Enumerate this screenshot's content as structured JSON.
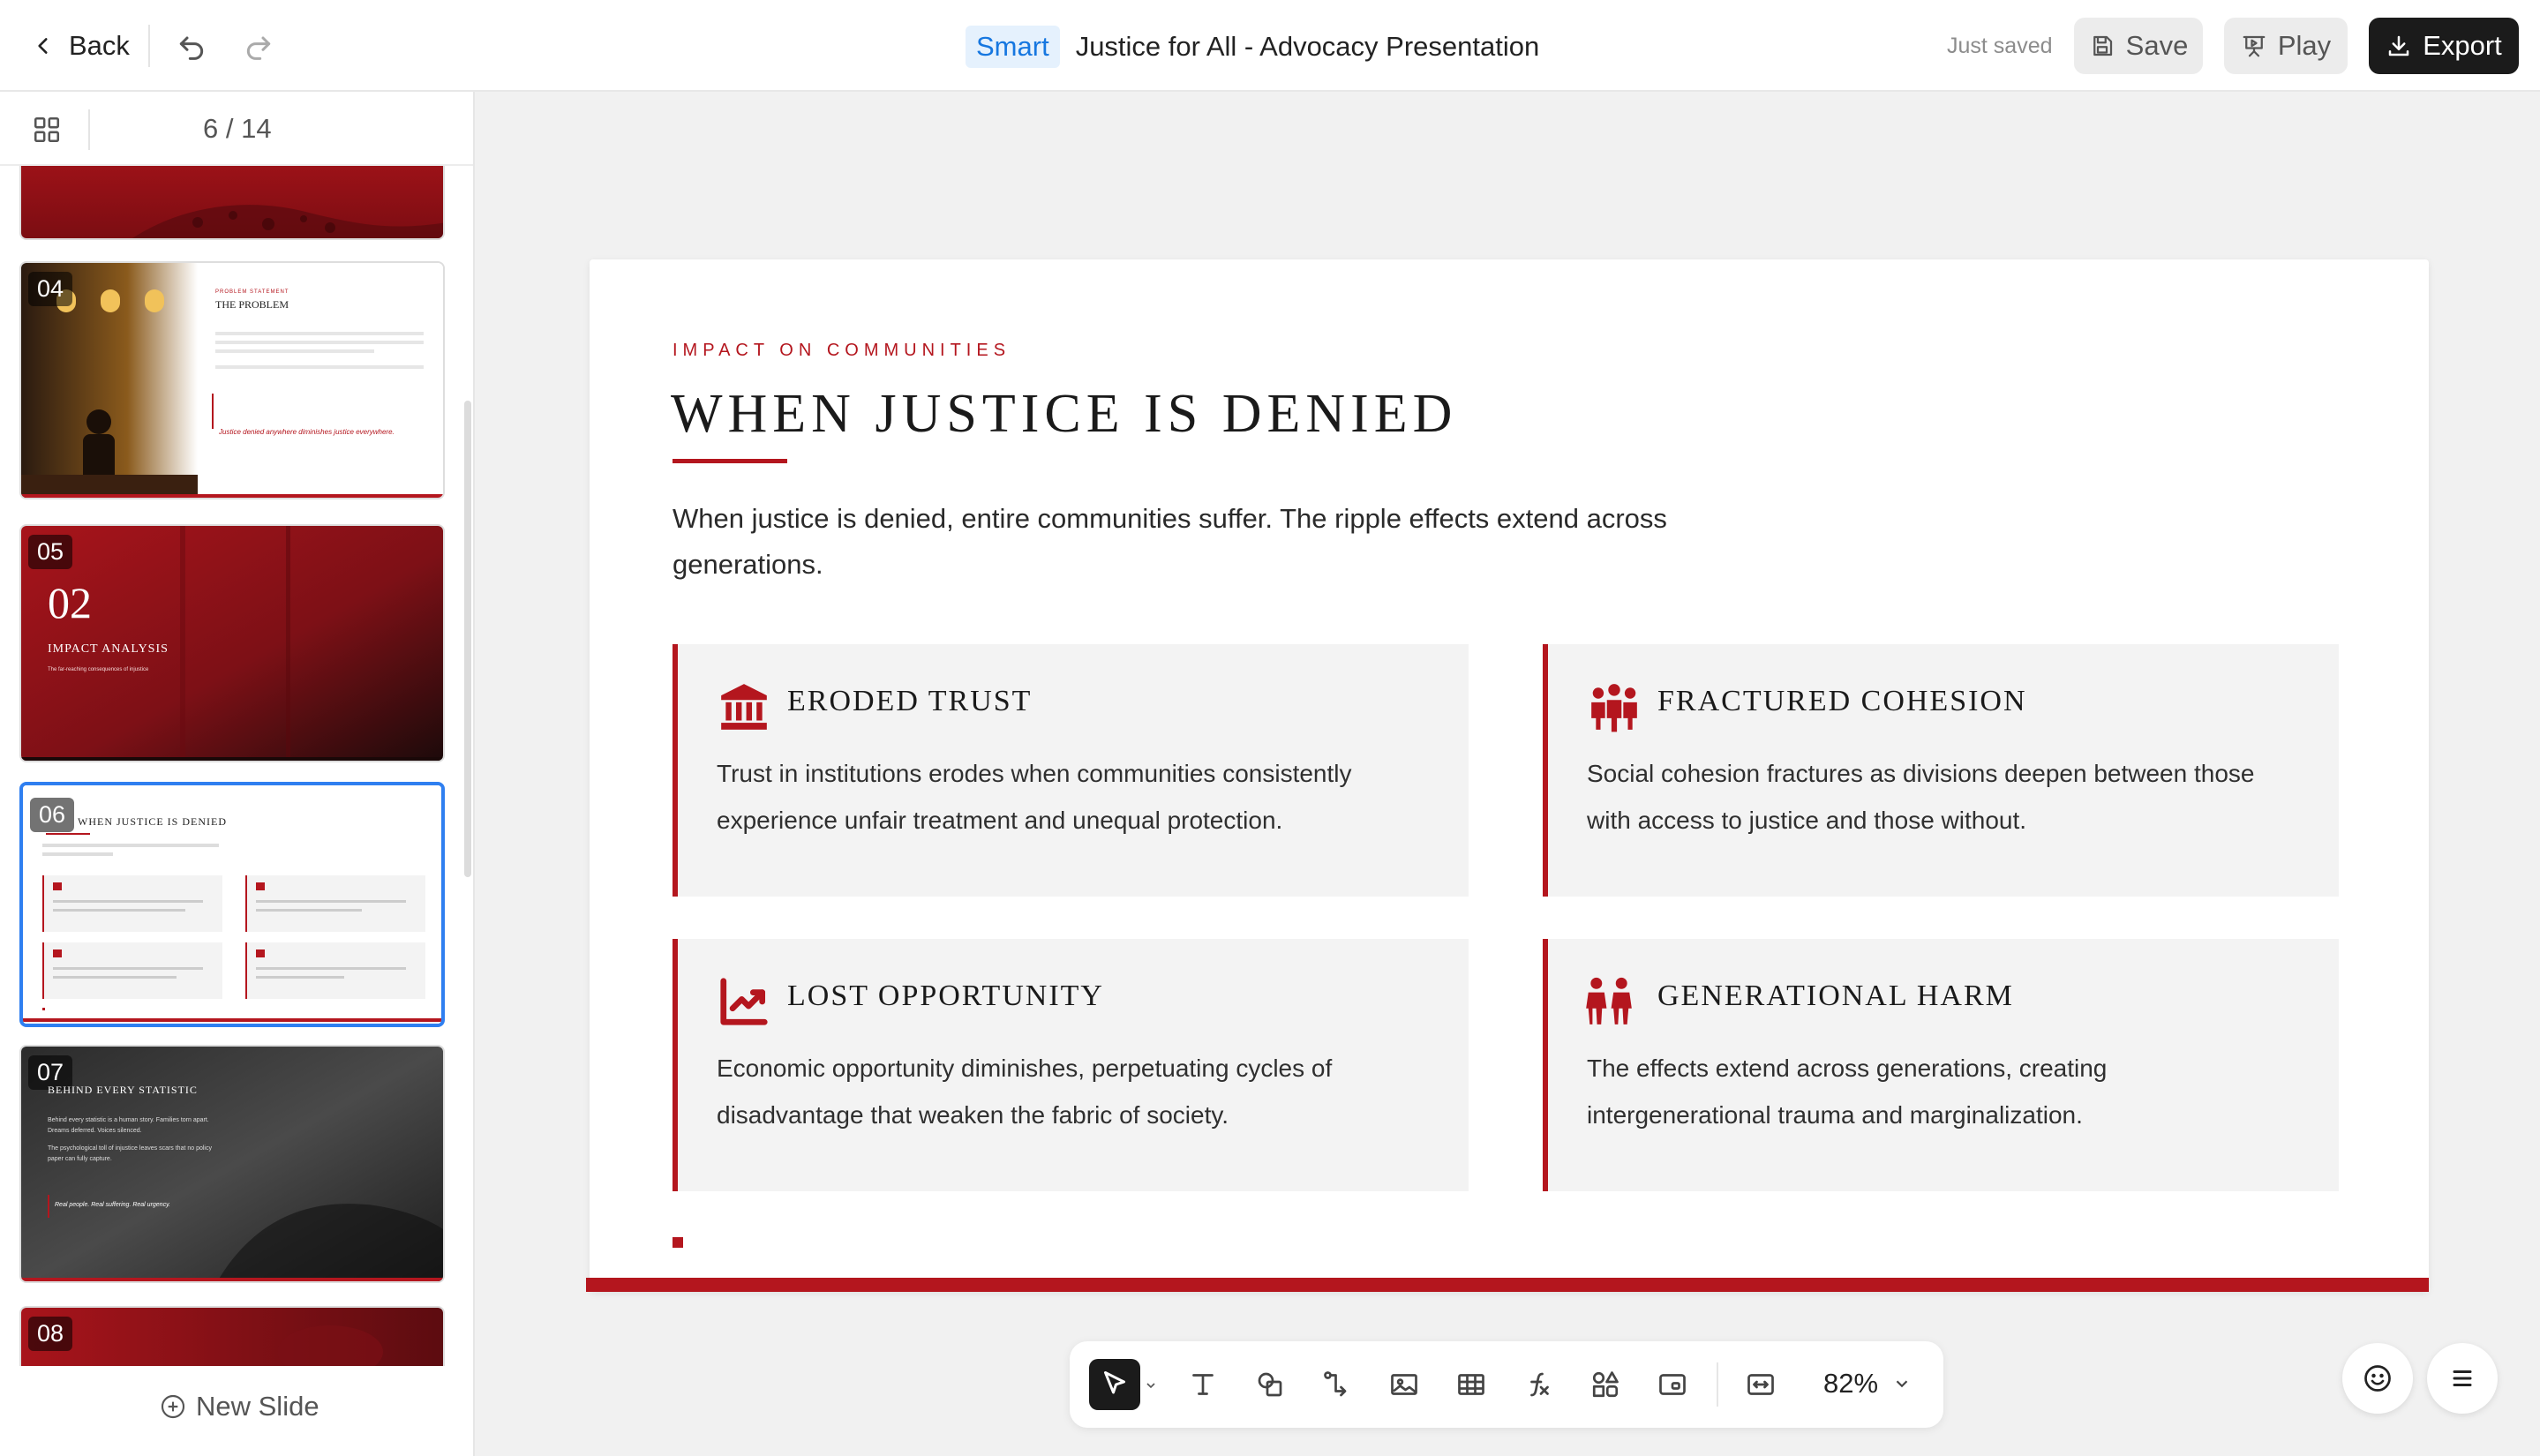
{
  "topbar": {
    "back_label": "Back",
    "smart_badge": "Smart",
    "doc_title": "Justice for All - Advocacy Presentation",
    "save_status": "Just saved",
    "save_label": "Save",
    "play_label": "Play",
    "export_label": "Export"
  },
  "sidebar": {
    "page_indicator": "6 / 14",
    "new_slide_label": "New Slide",
    "thumbnails": [
      {
        "num": "04",
        "kicker": "PROBLEM STATEMENT",
        "title": "THE PROBLEM",
        "quote": "Justice denied anywhere diminishes justice everywhere."
      },
      {
        "num": "05",
        "big": "02",
        "title": "IMPACT ANALYSIS",
        "sub": "The far-reaching consequences of injustice"
      },
      {
        "num": "06",
        "title": "WHEN JUSTICE IS DENIED"
      },
      {
        "num": "07",
        "title": "BEHIND EVERY STATISTIC",
        "line1": "Behind every statistic is a human story. Families torn apart. Dreams deferred. Voices silenced.",
        "line2": "The psychological toll of injustice leaves scars that no policy paper can fully capture.",
        "quote": "Real people. Real suffering. Real urgency."
      },
      {
        "num": "08"
      }
    ]
  },
  "slide": {
    "eyebrow": "IMPACT ON COMMUNITIES",
    "title": "WHEN JUSTICE IS DENIED",
    "lead": "When justice is denied, entire communities suffer. The ripple effects extend across generations.",
    "cards": [
      {
        "icon": "institution-icon",
        "title": "ERODED TRUST",
        "body": "Trust in institutions erodes when communities consistently experience unfair treatment and unequal protection."
      },
      {
        "icon": "people-group-icon",
        "title": "FRACTURED COHESION",
        "body": "Social cohesion fractures as divisions deepen between those with access to justice and those without."
      },
      {
        "icon": "chart-line-icon",
        "title": "LOST OPPORTUNITY",
        "body": "Economic opportunity diminishes, perpetuating cycles of disadvantage that weaken the fabric of society."
      },
      {
        "icon": "children-icon",
        "title": "GENERATIONAL HARM",
        "body": "The effects extend across generations, creating intergenerational trauma and marginalization."
      }
    ],
    "accent_color": "#b4161e"
  },
  "toolbar": {
    "zoom_label": "82%",
    "tools": [
      "select-tool",
      "text-tool",
      "shape-tool",
      "connector-tool",
      "image-tool",
      "table-tool",
      "formula-tool",
      "components-tool",
      "media-tool",
      "fit-tool"
    ]
  }
}
